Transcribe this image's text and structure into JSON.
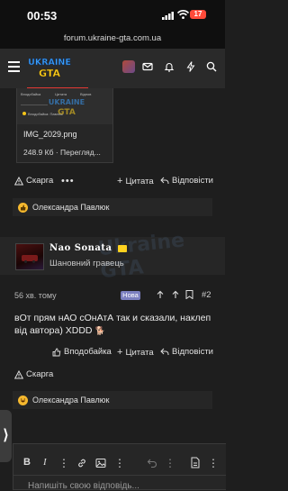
{
  "status_bar": {
    "time": "00:53",
    "battery": "17"
  },
  "browser": {
    "url": "forum.ukraine-gta.com.ua"
  },
  "header": {
    "logo_text": "UKRAINE GTA"
  },
  "attachment": {
    "filename": "IMG_2029.png",
    "meta": "248.9 Кб · Перегляд...",
    "thumb_labels": [
      "Вподобайка",
      "Цитата",
      "Відпов"
    ],
    "thumb_footer": "Вподобайка: Павлюк"
  },
  "post1_actions": {
    "report": "Скарга",
    "quote": "Цитата",
    "reply": "Відповісти"
  },
  "post1_reaction": {
    "user": "Олександра Павлюк"
  },
  "post2": {
    "username": "Nao Sonata",
    "user_title": "Шановний гравець",
    "time_ago": "56 хв. тому",
    "badge": "Нова",
    "post_number": "#2",
    "text": "вОт прям нАО сОнАтА так и сказали, наклеп від автора) XDDD",
    "like": "Вподобайка",
    "quote": "Цитата",
    "reply": "Відповісти",
    "report": "Скарга",
    "reaction_user": "Олександра Павлюк",
    "watermark": "Ukraine GTA"
  },
  "editor": {
    "placeholder": "Напишіть свою відповідь..."
  },
  "colors": {
    "accent": "#e53935",
    "badge": "#7b7fbf",
    "background": "#1e1e1e"
  }
}
